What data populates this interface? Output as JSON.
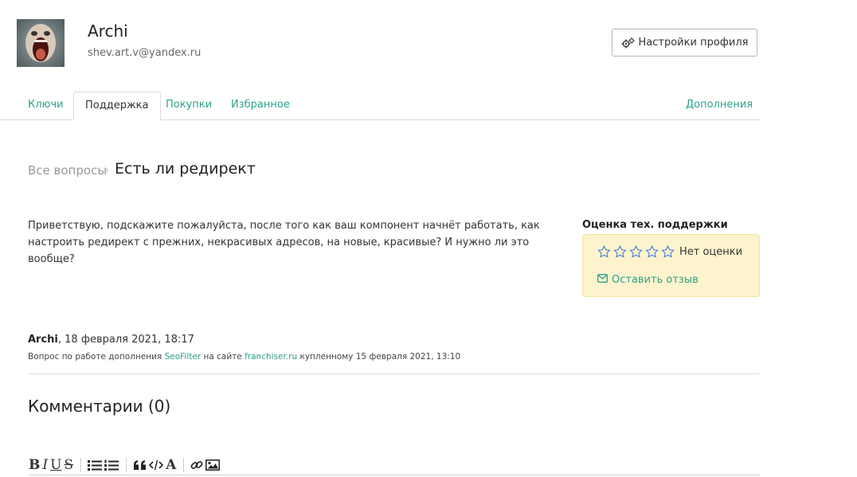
{
  "user": {
    "name": "Archi",
    "email": "shev.art.v@yandex.ru"
  },
  "header": {
    "settings_label": "Настройки профиля"
  },
  "tabs": [
    {
      "label": "Ключи"
    },
    {
      "label": "Поддержка"
    },
    {
      "label": "Покупки"
    },
    {
      "label": "Избранное"
    },
    {
      "label": "Дополнения"
    }
  ],
  "breadcrumb": {
    "all_label": "Все вопросы",
    "separator": "›",
    "current": "Есть ли редирект"
  },
  "question": {
    "text": "Приветствую, подскажите пожалуйста, после того как ваш компонент начнёт работать, как настроить редирект с прежних, некрасивых адресов, на новые, красивые? И нужно ли это вообще?",
    "author": "Archi",
    "date": ", 18 февраля 2021, 18:17",
    "meta_prefix": "Вопрос по работе дополнения",
    "addon": "SeoFilter",
    "meta_middle": "на сайте",
    "site": "franchiser.ru",
    "meta_suffix": "купленному 15 февраля 2021, 13:10"
  },
  "rating": {
    "title": "Оценка тех. поддержки",
    "value": 0,
    "max": 5,
    "no_rating_label": "Нет оценки",
    "review_label": "Оставить отзыв"
  },
  "comments": {
    "title": "Комментарии (0)"
  },
  "editor": {
    "bold_glyph": "B",
    "italic_glyph": "I",
    "underline_glyph": "U",
    "strike_glyph": "S",
    "font_glyph": "A"
  },
  "colors": {
    "accent": "#2ea08a",
    "rating_bg": "#fdf3cc",
    "star": "#4a7fd6"
  }
}
